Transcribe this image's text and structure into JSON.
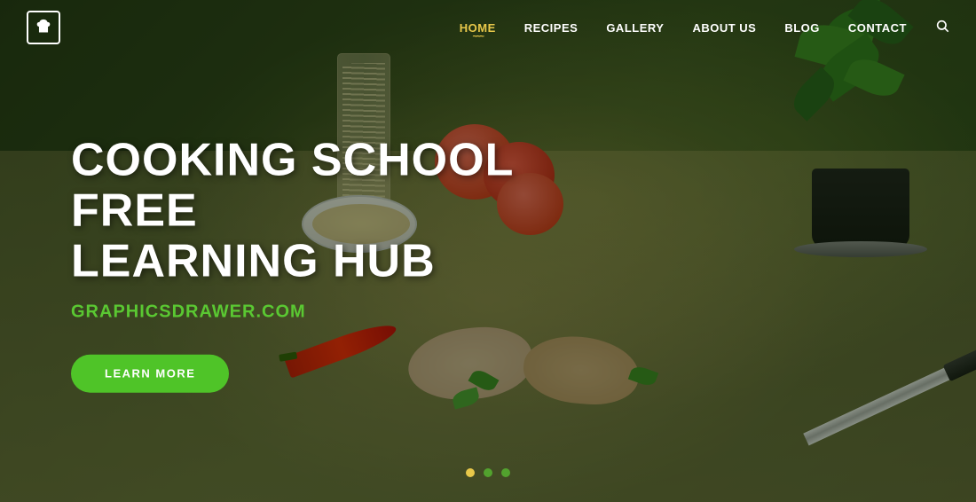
{
  "nav": {
    "logo_icon": "🍳",
    "items": [
      {
        "label": "HOME",
        "active": true
      },
      {
        "label": "RECIPES",
        "active": false
      },
      {
        "label": "GALLERY",
        "active": false
      },
      {
        "label": "ABOUT US",
        "active": false
      },
      {
        "label": "BLOG",
        "active": false
      },
      {
        "label": "CONTACT",
        "active": false
      }
    ],
    "search_label": "🔍"
  },
  "hero": {
    "title_line1": "COOKING SCHOOL FREE",
    "title_line2": "LEARNING HUB",
    "subtitle": "GRAPHICSDRAWER.COM",
    "cta_button": "LEARN MORE"
  },
  "slider": {
    "dots": [
      {
        "state": "active"
      },
      {
        "state": "inactive"
      },
      {
        "state": "inactive"
      }
    ]
  }
}
